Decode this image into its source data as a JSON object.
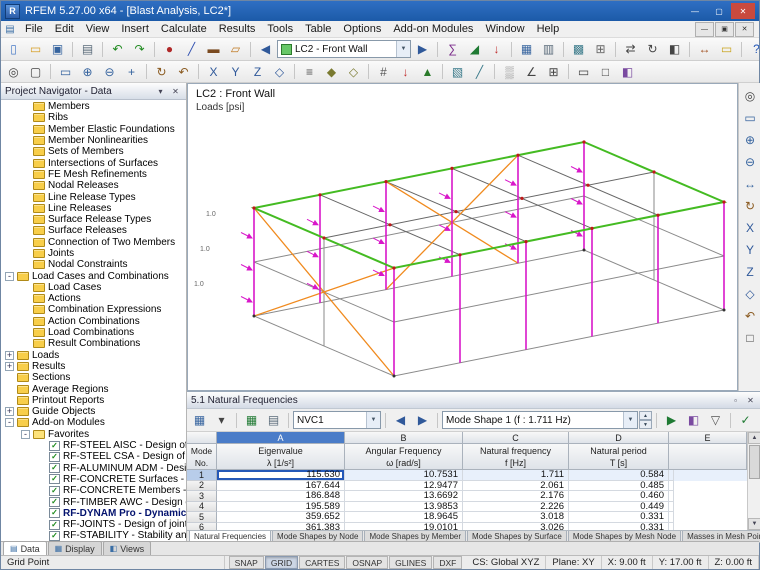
{
  "window": {
    "title": "RFEM 5.27.00 x64 - [Blast Analysis, LC2*]"
  },
  "icons": {
    "app": "R",
    "chevron_down": "▼",
    "menu_doc": "▤",
    "scroll_up": "▲",
    "scroll_down": "▼"
  },
  "titlebar_buttons": [
    {
      "n": "minimize-button",
      "g": "—"
    },
    {
      "n": "maximize-button",
      "g": "▢"
    },
    {
      "n": "close-button",
      "g": "✕"
    }
  ],
  "mdi_buttons": [
    {
      "n": "mdi-minimize-button",
      "g": "—"
    },
    {
      "n": "mdi-restore-button",
      "g": "▣"
    },
    {
      "n": "mdi-close-button",
      "g": "✕"
    }
  ],
  "menu": {
    "items": [
      "File",
      "Edit",
      "View",
      "Insert",
      "Calculate",
      "Results",
      "Tools",
      "Table",
      "Options",
      "Add-on Modules",
      "Window",
      "Help"
    ]
  },
  "toolbar_main": {
    "load_case_combo": "LC2 - Front Wall",
    "part1": [
      {
        "n": "new-model-icon",
        "g": "▯",
        "c": "#4a7cc8"
      },
      {
        "n": "open-file-icon",
        "g": "▭",
        "c": "#d8a029"
      },
      {
        "n": "save-icon",
        "g": "▣",
        "c": "#35639e"
      },
      {
        "n": "separator",
        "g": "",
        "cls": "sep",
        "inter": "false"
      },
      {
        "n": "print-icon",
        "g": "▤",
        "c": "#5a6b7a"
      },
      {
        "n": "separator",
        "g": "",
        "cls": "sep",
        "inter": "false"
      },
      {
        "n": "undo-icon",
        "g": "↶",
        "c": "#1f8a1f"
      },
      {
        "n": "redo-icon",
        "g": "↷",
        "c": "#1f8a1f"
      },
      {
        "n": "separator",
        "g": "",
        "cls": "sep",
        "inter": "false"
      },
      {
        "n": "new-node-icon",
        "g": "●",
        "c": "#b02828"
      },
      {
        "n": "new-line-icon",
        "g": "╱",
        "c": "#3050b0"
      },
      {
        "n": "new-member-icon",
        "g": "▬",
        "c": "#7a4a20"
      },
      {
        "n": "new-surface-icon",
        "g": "▱",
        "c": "#c07820"
      },
      {
        "n": "separator",
        "g": "",
        "cls": "sep",
        "inter": "false"
      },
      {
        "n": "prev-load-case-icon",
        "g": "◀",
        "c": "#30599a"
      }
    ],
    "part2": [
      {
        "n": "next-load-case-icon",
        "g": "▶",
        "c": "#30599a"
      },
      {
        "n": "separator",
        "g": "",
        "cls": "sep",
        "inter": "false"
      },
      {
        "n": "calculate-all-icon",
        "g": "∑",
        "c": "#7a2a8a"
      },
      {
        "n": "show-results-icon",
        "g": "◢",
        "c": "#1f7a33"
      },
      {
        "n": "show-loads-icon",
        "g": "↓",
        "c": "#c03030"
      },
      {
        "n": "separator",
        "g": "",
        "cls": "sep",
        "inter": "false"
      },
      {
        "n": "tables-icon",
        "g": "▦",
        "c": "#35639e"
      },
      {
        "n": "printout-report-icon",
        "g": "▥",
        "c": "#5a6b7a"
      },
      {
        "n": "separator",
        "g": "",
        "cls": "sep",
        "inter": "false"
      },
      {
        "n": "generate-mesh-icon",
        "g": "▩",
        "c": "#3a7a8a"
      },
      {
        "n": "fe-mesh-settings-icon",
        "g": "⊞",
        "c": "#666666"
      },
      {
        "n": "separator",
        "g": "",
        "cls": "sep",
        "inter": "false"
      },
      {
        "n": "move-copy-icon",
        "g": "⇄",
        "c": "#444444"
      },
      {
        "n": "rotate-icon",
        "g": "↻",
        "c": "#444444"
      },
      {
        "n": "mirror-icon",
        "g": "◧",
        "c": "#444444"
      },
      {
        "n": "separator",
        "g": "",
        "cls": "sep",
        "inter": "false"
      },
      {
        "n": "dimension-icon",
        "g": "↔",
        "c": "#a05020"
      },
      {
        "n": "comment-icon",
        "g": "▭",
        "c": "#caa520"
      },
      {
        "n": "separator",
        "g": "",
        "cls": "sep",
        "inter": "false"
      },
      {
        "n": "help-icon",
        "g": "?",
        "c": "#2458b8"
      }
    ]
  },
  "toolbar_view": {
    "icons": [
      {
        "n": "edit-select-icon",
        "g": "◎",
        "c": "#444444"
      },
      {
        "n": "select-special-icon",
        "g": "▢",
        "c": "#444444"
      },
      {
        "n": "separator",
        "g": "",
        "cls": "sep",
        "inter": "false"
      },
      {
        "n": "zoom-window-icon",
        "g": "▭",
        "c": "#35639e"
      },
      {
        "n": "zoom-in-icon",
        "g": "⊕",
        "c": "#35639e"
      },
      {
        "n": "zoom-out-icon",
        "g": "⊖",
        "c": "#35639e"
      },
      {
        "n": "pan-view-icon",
        "g": "+",
        "c": "#35639e"
      },
      {
        "n": "separator",
        "g": "",
        "cls": "sep",
        "inter": "false"
      },
      {
        "n": "rotate-view-icon",
        "g": "↻",
        "c": "#8a5a20"
      },
      {
        "n": "previous-view-icon",
        "g": "↶",
        "c": "#8a5a20"
      },
      {
        "n": "separator",
        "g": "",
        "cls": "sep",
        "inter": "false"
      },
      {
        "n": "view-x-icon",
        "g": "X",
        "c": "#30599a"
      },
      {
        "n": "view-y-icon",
        "g": "Y",
        "c": "#30599a"
      },
      {
        "n": "view-z-icon",
        "g": "Z",
        "c": "#30599a"
      },
      {
        "n": "isometric-view-icon",
        "g": "◇",
        "c": "#30599a"
      },
      {
        "n": "separator",
        "g": "",
        "cls": "sep",
        "inter": "false"
      },
      {
        "n": "display-properties-icon",
        "g": "≡",
        "c": "#555555"
      },
      {
        "n": "render-solid-icon",
        "g": "◆",
        "c": "#7a7a30"
      },
      {
        "n": "render-wireframe-icon",
        "g": "◇",
        "c": "#7a7a30"
      },
      {
        "n": "separator",
        "g": "",
        "cls": "sep",
        "inter": "false"
      },
      {
        "n": "show-numbering-icon",
        "g": "#",
        "c": "#555555"
      },
      {
        "n": "show-loads-icon",
        "g": "↓",
        "c": "#c03030"
      },
      {
        "n": "show-supports-icon",
        "g": "▲",
        "c": "#2a7a2a"
      },
      {
        "n": "separator",
        "g": "",
        "cls": "sep",
        "inter": "false"
      },
      {
        "n": "clipping-plane-icon",
        "g": "▧",
        "c": "#3a7a8a"
      },
      {
        "n": "section-icon",
        "g": "╱",
        "c": "#3a7a8a"
      },
      {
        "n": "separator",
        "g": "",
        "cls": "sep",
        "inter": "false"
      },
      {
        "n": "background-icon",
        "g": "▒",
        "c": "#888888"
      },
      {
        "n": "axes-icon",
        "g": "∠",
        "c": "#444444"
      },
      {
        "n": "grid-icon",
        "g": "⊞",
        "c": "#444444"
      },
      {
        "n": "separator",
        "g": "",
        "cls": "sep",
        "inter": "false"
      },
      {
        "n": "margins-icon",
        "g": "▭",
        "c": "#444444"
      },
      {
        "n": "fullscreen-icon",
        "g": "□",
        "c": "#444444"
      },
      {
        "n": "control-panel-icon",
        "g": "◧",
        "c": "#7a4aa0"
      }
    ]
  },
  "navigator": {
    "title": "Project Navigator - Data",
    "header_buttons": [
      {
        "n": "navigator-pin-icon",
        "g": "▾"
      },
      {
        "n": "navigator-close-icon",
        "g": "✕"
      }
    ],
    "tree": [
      {
        "label": "Members",
        "cls": "lvl2",
        "icon": "i-folder",
        "exp": ""
      },
      {
        "label": "Ribs",
        "cls": "lvl2",
        "icon": "i-folder",
        "exp": ""
      },
      {
        "label": "Member Elastic Foundations",
        "cls": "lvl2",
        "icon": "i-folder",
        "exp": ""
      },
      {
        "label": "Member Nonlinearities",
        "cls": "lvl2",
        "icon": "i-folder",
        "exp": ""
      },
      {
        "label": "Sets of Members",
        "cls": "lvl2",
        "icon": "i-folder",
        "exp": ""
      },
      {
        "label": "Intersections of Surfaces",
        "cls": "lvl2",
        "icon": "i-folder",
        "exp": ""
      },
      {
        "label": "FE Mesh Refinements",
        "cls": "lvl2",
        "icon": "i-folder",
        "exp": ""
      },
      {
        "label": "Nodal Releases",
        "cls": "lvl2",
        "icon": "i-folder",
        "exp": ""
      },
      {
        "label": "Line Release Types",
        "cls": "lvl2",
        "icon": "i-folder",
        "exp": ""
      },
      {
        "label": "Line Releases",
        "cls": "lvl2",
        "icon": "i-folder",
        "exp": ""
      },
      {
        "label": "Surface Release Types",
        "cls": "lvl2",
        "icon": "i-folder",
        "exp": ""
      },
      {
        "label": "Surface Releases",
        "cls": "lvl2",
        "icon": "i-folder",
        "exp": ""
      },
      {
        "label": "Connection of Two Members",
        "cls": "lvl2",
        "icon": "i-folder",
        "exp": ""
      },
      {
        "label": "Joints",
        "cls": "lvl2",
        "icon": "i-folder",
        "exp": ""
      },
      {
        "label": "Nodal Constraints",
        "cls": "lvl2",
        "icon": "i-folder",
        "exp": ""
      },
      {
        "label": "Load Cases and Combinations",
        "cls": "lvl1",
        "icon": "i-folder",
        "exp": "-"
      },
      {
        "label": "Load Cases",
        "cls": "lvl2",
        "icon": "i-folder",
        "exp": ""
      },
      {
        "label": "Actions",
        "cls": "lvl2",
        "icon": "i-folder",
        "exp": ""
      },
      {
        "label": "Combination Expressions",
        "cls": "lvl2",
        "icon": "i-folder",
        "exp": ""
      },
      {
        "label": "Action Combinations",
        "cls": "lvl2",
        "icon": "i-folder",
        "exp": ""
      },
      {
        "label": "Load Combinations",
        "cls": "lvl2",
        "icon": "i-folder",
        "exp": ""
      },
      {
        "label": "Result Combinations",
        "cls": "lvl2",
        "icon": "i-folder",
        "exp": ""
      },
      {
        "label": "Loads",
        "cls": "lvl1",
        "icon": "i-folder",
        "exp": "+"
      },
      {
        "label": "Results",
        "cls": "lvl1",
        "icon": "i-folder",
        "exp": "+"
      },
      {
        "label": "Sections",
        "cls": "lvl1",
        "icon": "i-folder",
        "exp": ""
      },
      {
        "label": "Average Regions",
        "cls": "lvl1",
        "icon": "i-folder",
        "exp": ""
      },
      {
        "label": "Printout Reports",
        "cls": "lvl1",
        "icon": "i-folder",
        "exp": ""
      },
      {
        "label": "Guide Objects",
        "cls": "lvl1",
        "icon": "i-folder",
        "exp": "+"
      },
      {
        "label": "Add-on Modules",
        "cls": "lvl1",
        "icon": "i-folder",
        "exp": "-"
      },
      {
        "label": "Favorites",
        "cls": "lvl2",
        "icon": "i-folder-open",
        "exp": "-"
      },
      {
        "label": "RF-STEEL AISC - Design of stee",
        "cls": "lvl3",
        "icon": "i-mod",
        "exp": ""
      },
      {
        "label": "RF-STEEL CSA - Design of steel",
        "cls": "lvl3",
        "icon": "i-mod",
        "exp": ""
      },
      {
        "label": "RF-ALUMINUM ADM - Design",
        "cls": "lvl3",
        "icon": "i-mod",
        "exp": ""
      },
      {
        "label": "RF-CONCRETE Surfaces - Desi",
        "cls": "lvl3",
        "icon": "i-mod",
        "exp": ""
      },
      {
        "label": "RF-CONCRETE Members - Des",
        "cls": "lvl3",
        "icon": "i-mod",
        "exp": ""
      },
      {
        "label": "RF-TIMBER AWC - Design of ti",
        "cls": "lvl3",
        "icon": "i-mod",
        "exp": ""
      },
      {
        "label": "RF-DYNAM Pro - Dynamic an",
        "cls": "lvl3 sel",
        "icon": "i-mod",
        "exp": ""
      },
      {
        "label": "RF-JOINTS - Design of joints",
        "cls": "lvl3",
        "icon": "i-mod",
        "exp": ""
      },
      {
        "label": "RF-STABILITY - Stability analys",
        "cls": "lvl3",
        "icon": "i-mod",
        "exp": ""
      }
    ],
    "tabs": [
      {
        "label": "Data",
        "cls": "active",
        "g": "▤"
      },
      {
        "label": "Display",
        "g": "▦"
      },
      {
        "label": "Views",
        "g": "◧"
      }
    ]
  },
  "viewport": {
    "load_case_label": "LC2 : Front Wall",
    "loads_label": "Loads [psi]",
    "scale_labels": [
      "1.0",
      "1.0",
      "1.0"
    ]
  },
  "right_rail": {
    "icons": [
      {
        "n": "select-icon",
        "g": "◎",
        "c": "#444444"
      },
      {
        "n": "zoom-window-icon",
        "g": "▭",
        "c": "#35639e"
      },
      {
        "n": "zoom-in-icon",
        "g": "⊕",
        "c": "#35639e"
      },
      {
        "n": "zoom-out-icon",
        "g": "⊖",
        "c": "#35639e"
      },
      {
        "n": "move-view-icon",
        "g": "↔",
        "c": "#35639e"
      },
      {
        "n": "rotate-view-icon",
        "g": "↻",
        "c": "#8a5a20"
      },
      {
        "n": "view-x-icon",
        "g": "X",
        "c": "#30599a"
      },
      {
        "n": "view-y-icon",
        "g": "Y",
        "c": "#30599a"
      },
      {
        "n": "view-z-icon",
        "g": "Z",
        "c": "#30599a"
      },
      {
        "n": "isometric-view-icon",
        "g": "◇",
        "c": "#30599a"
      },
      {
        "n": "previous-view-icon",
        "g": "↶",
        "c": "#8a5a20"
      },
      {
        "n": "show-full-model-icon",
        "g": "□",
        "c": "#444444"
      }
    ]
  },
  "results_panel": {
    "title": "5.1 Natural Frequencies",
    "header_buttons": [
      {
        "n": "panel-undock-icon",
        "g": "▫"
      },
      {
        "n": "panel-close-icon",
        "g": "✕"
      }
    ],
    "toolbar": {
      "combo_nvc": "NVC1",
      "combo_mode": "Mode Shape 1 (f : 1.711 Hz)",
      "group1": [
        {
          "n": "table-settings-icon",
          "g": "▦",
          "c": "#35639e"
        },
        {
          "n": "table-menu-chevron-icon",
          "g": "▾",
          "c": "#444444"
        },
        {
          "n": "separator",
          "g": "",
          "cls": "sep",
          "inter": "false"
        },
        {
          "n": "export-excel-icon",
          "g": "▦",
          "c": "#1f7a33"
        },
        {
          "n": "print-table-icon",
          "g": "▤",
          "c": "#5a6b7a"
        },
        {
          "n": "separator",
          "g": "",
          "cls": "sep",
          "inter": "false"
        }
      ],
      "group2": [
        {
          "n": "separator",
          "g": "",
          "cls": "sep",
          "inter": "false"
        },
        {
          "n": "prev-mode-icon",
          "g": "◀",
          "c": "#30599a"
        },
        {
          "n": "next-mode-icon",
          "g": "▶",
          "c": "#30599a"
        },
        {
          "n": "separator",
          "g": "",
          "cls": "sep",
          "inter": "false"
        }
      ],
      "group3": [
        {
          "n": "separator",
          "g": "",
          "cls": "sep",
          "inter": "false"
        },
        {
          "n": "animate-mode-icon",
          "g": "▶",
          "c": "#1f7a33"
        },
        {
          "n": "result-diagram-icon",
          "g": "◧",
          "c": "#7a4aa0"
        },
        {
          "n": "filter-icon",
          "g": "▽",
          "c": "#555555"
        },
        {
          "n": "separator",
          "g": "",
          "cls": "sep",
          "inter": "false"
        },
        {
          "n": "apply-icon",
          "g": "✓",
          "c": "#1f7a33"
        },
        {
          "n": "cancel-icon",
          "g": "✕",
          "c": "#b33030"
        }
      ],
      "group4": [
        {
          "n": "color-scale-icon",
          "g": "▥",
          "c": "#caa520"
        },
        {
          "n": "table-help-icon",
          "g": "?",
          "c": "#2458b8"
        }
      ]
    },
    "table": {
      "mode_header": {
        "line1": "Mode",
        "line2": "No."
      },
      "cols": [
        {
          "letter": "A",
          "title": "Eigenvalue",
          "sym": "λ [1/s²]",
          "wcls": "w-a",
          "hcls": "w-a sel-col"
        },
        {
          "letter": "B",
          "title": "Angular Frequency",
          "sym": "ω [rad/s]",
          "wcls": "w-b",
          "hcls": "w-b"
        },
        {
          "letter": "C",
          "title": "Natural frequency",
          "sym": "f [Hz]",
          "wcls": "w-c",
          "hcls": "w-c"
        },
        {
          "letter": "D",
          "title": "Natural period",
          "sym": "T [s]",
          "wcls": "w-d",
          "hcls": "w-d"
        },
        {
          "letter": "E",
          "title": "",
          "sym": "",
          "wcls": "w-e",
          "hcls": "w-e"
        }
      ],
      "rows": [
        {
          "no": "1",
          "a": "115.630",
          "b": "10.7531",
          "c": "1.711",
          "d": "0.584",
          "e": "",
          "cls": "current"
        },
        {
          "no": "2",
          "a": "167.644",
          "b": "12.9477",
          "c": "2.061",
          "d": "0.485",
          "e": ""
        },
        {
          "no": "3",
          "a": "186.848",
          "b": "13.6692",
          "c": "2.176",
          "d": "0.460",
          "e": ""
        },
        {
          "no": "4",
          "a": "195.589",
          "b": "13.9853",
          "c": "2.226",
          "d": "0.449",
          "e": ""
        },
        {
          "no": "5",
          "a": "359.652",
          "b": "18.9645",
          "c": "3.018",
          "d": "0.331",
          "e": ""
        },
        {
          "no": "6",
          "a": "361.383",
          "b": "19.0101",
          "c": "3.026",
          "d": "0.331",
          "e": ""
        }
      ]
    },
    "tabs": [
      {
        "label": "Natural Frequencies",
        "cls": "active"
      },
      {
        "label": "Mode Shapes by Node"
      },
      {
        "label": "Mode Shapes by Member"
      },
      {
        "label": "Mode Shapes by Surface"
      },
      {
        "label": "Mode Shapes by Mesh Node"
      },
      {
        "label": "Masses in Mesh Points"
      }
    ]
  },
  "statusbar": {
    "hint": "Grid Point",
    "buttons": [
      {
        "label": "SNAP"
      },
      {
        "label": "GRID",
        "cls": "pressed"
      },
      {
        "label": "CARTES"
      },
      {
        "label": "OSNAP"
      },
      {
        "label": "GLINES"
      },
      {
        "label": "DXF"
      }
    ],
    "cs": "CS: Global XYZ",
    "plane": "Plane: XY",
    "x": "X: 9.00 ft",
    "y": "Y: 17.00 ft",
    "z": "Z: 0.00 ft"
  }
}
